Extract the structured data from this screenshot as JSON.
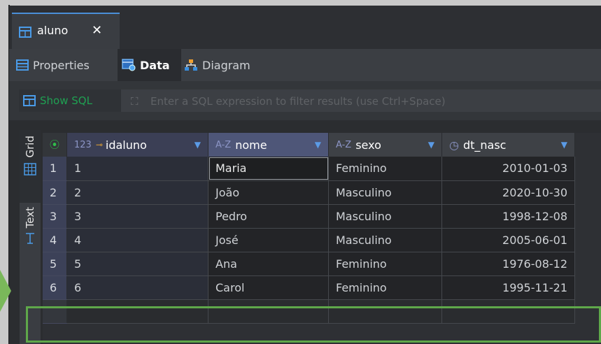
{
  "editor_tab": {
    "label": "aluno",
    "close": "✕"
  },
  "subtabs": [
    {
      "label": "Properties",
      "active": false
    },
    {
      "label": "Data",
      "active": true
    },
    {
      "label": "Diagram",
      "active": false
    }
  ],
  "filter": {
    "show_sql": "Show SQL",
    "placeholder": "Enter a SQL expression to filter results (use Ctrl+Space)"
  },
  "side_tabs": [
    {
      "label": "Grid",
      "active": true
    },
    {
      "label": "Text",
      "active": false
    }
  ],
  "columns": [
    {
      "type_icon": "123",
      "key_icon": "⊸",
      "label": "idaluno"
    },
    {
      "type_icon": "A-Z",
      "label": "nome"
    },
    {
      "type_icon": "A-Z",
      "label": "sexo"
    },
    {
      "type_icon": "◷",
      "label": "dt_nasc"
    }
  ],
  "rows": [
    {
      "n": "1",
      "idaluno": "1",
      "nome": "Maria",
      "sexo": "Feminino",
      "dt_nasc": "2010-01-03"
    },
    {
      "n": "2",
      "idaluno": "2",
      "nome": "João",
      "sexo": "Masculino",
      "dt_nasc": "2020-10-30"
    },
    {
      "n": "3",
      "idaluno": "3",
      "nome": "Pedro",
      "sexo": "Masculino",
      "dt_nasc": "1998-12-08"
    },
    {
      "n": "4",
      "idaluno": "4",
      "nome": "José",
      "sexo": "Masculino",
      "dt_nasc": "2005-06-01"
    },
    {
      "n": "5",
      "idaluno": "5",
      "nome": "Ana",
      "sexo": "Feminino",
      "dt_nasc": "1976-08-12"
    },
    {
      "n": "6",
      "idaluno": "6",
      "nome": "Carol",
      "sexo": "Feminino",
      "dt_nasc": "1995-11-21"
    }
  ],
  "colors": {
    "accent": "#4a8fd8",
    "show_sql": "#1fa052",
    "highlight": "#5fa84a"
  }
}
